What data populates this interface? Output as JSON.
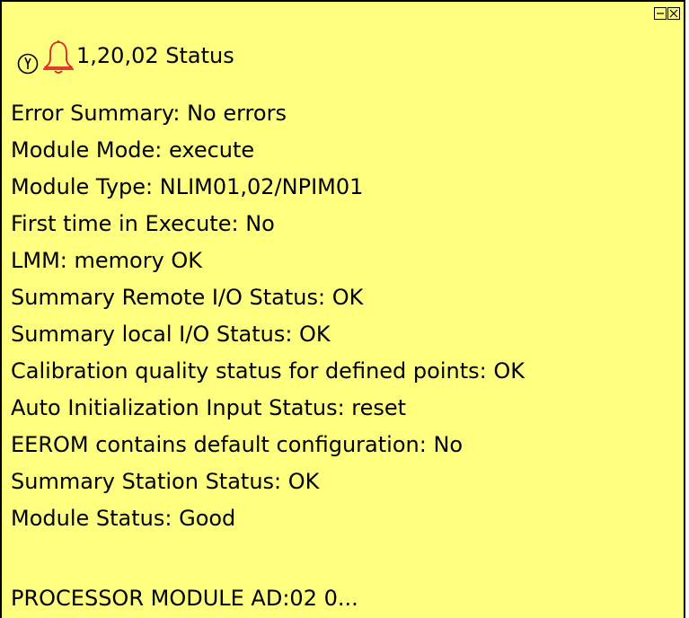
{
  "window": {
    "title": "1,20,02 Status",
    "controls": {
      "minimize_icon": "minimize-icon",
      "close_icon": "close-icon"
    },
    "icons": [
      "clock-icon",
      "bell-icon"
    ]
  },
  "status_lines": [
    "Error Summary: No errors",
    "Module Mode: execute",
    "Module Type: NLIM01,02/NPIM01",
    "First time in Execute: No",
    "LMM: memory OK",
    "Summary Remote I/O Status: OK",
    "Summary local I/O Status: OK",
    "Calibration quality status for defined points: OK",
    "Auto Initialization Input Status: reset",
    "EEROM contains default configuration: No",
    "Summary Station Status: OK",
    "Module Status: Good"
  ],
  "footer": "PROCESSOR MODULE AD:02 0...",
  "colors": {
    "background": "#ffff80",
    "text": "#000000",
    "bell": "#e02020"
  }
}
